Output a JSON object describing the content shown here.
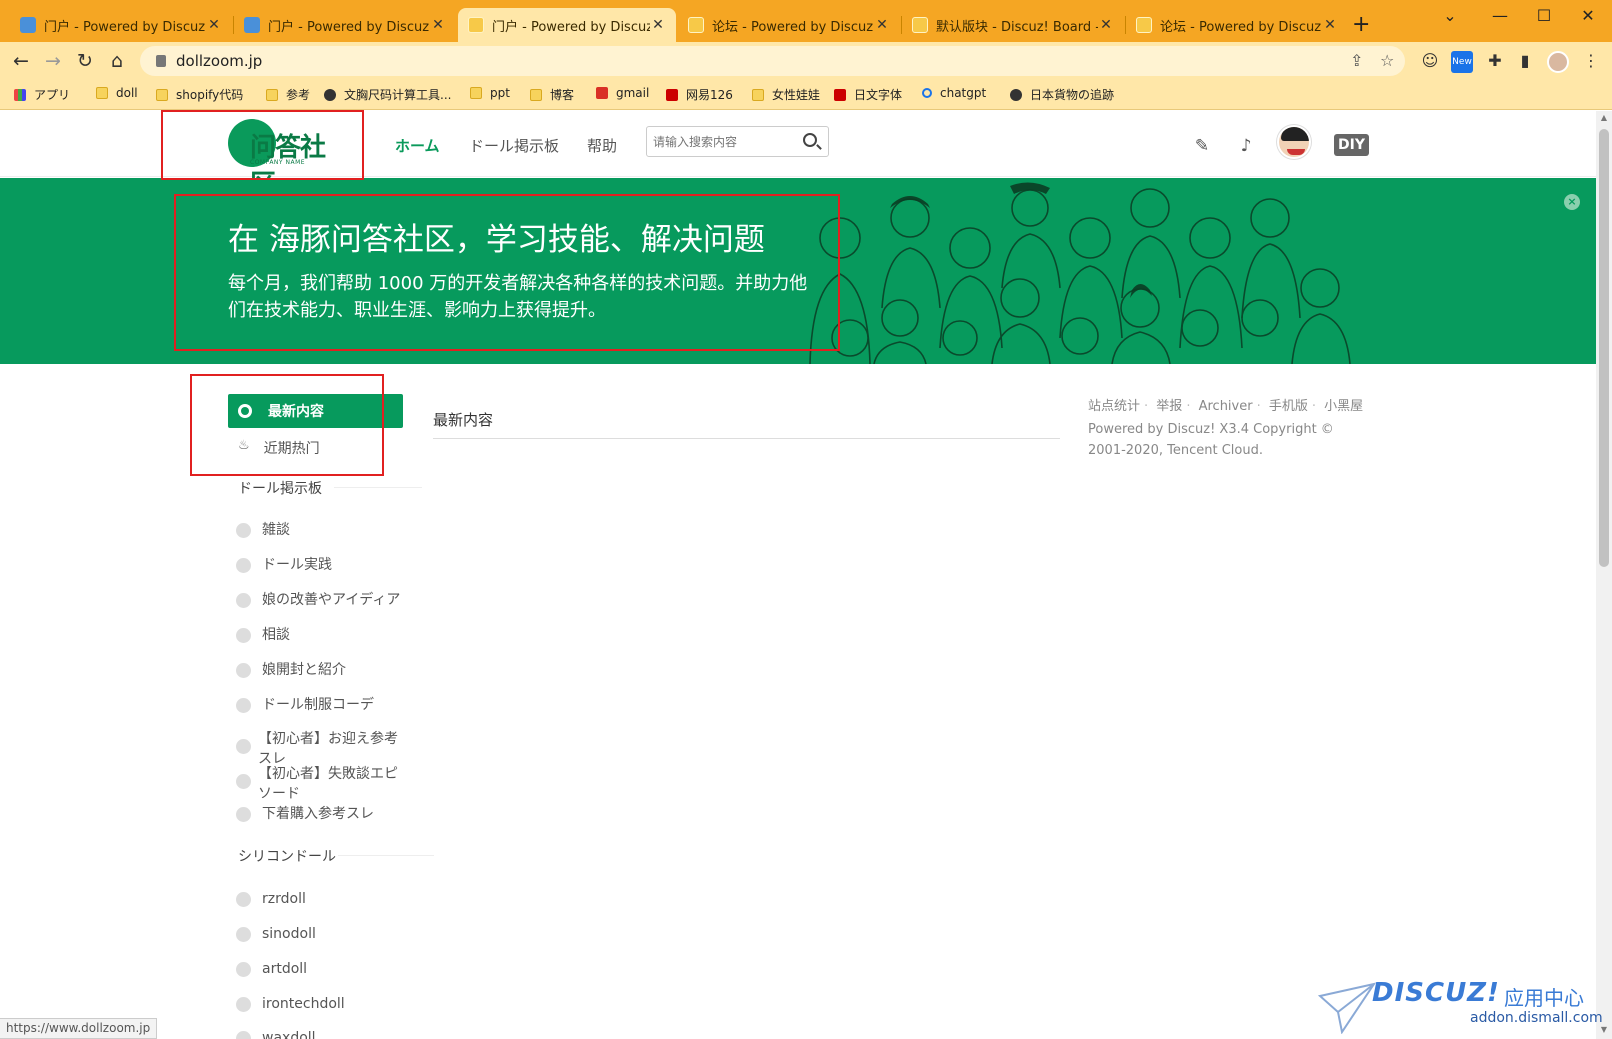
{
  "browser": {
    "tabs": [
      {
        "title": "门户 - Powered by Discuz!",
        "fav": "blue"
      },
      {
        "title": "门户 - Powered by Discuz!",
        "fav": "blue"
      },
      {
        "title": "门户 - Powered by Discuz!",
        "fav": "yel",
        "active": true
      },
      {
        "title": "论坛 - Powered by Discuz!",
        "fav": "yel"
      },
      {
        "title": "默认版块 - Discuz! Board - P",
        "fav": "yel"
      },
      {
        "title": "论坛 - Powered by Discuz!",
        "fav": "yel"
      }
    ],
    "url": "dollzoom.jp",
    "new_badge": "New",
    "bookmarks": [
      {
        "label": "アプリ",
        "icon": "grid"
      },
      {
        "label": "doll",
        "icon": "folder"
      },
      {
        "label": "shopify代码",
        "icon": "folder"
      },
      {
        "label": "参考",
        "icon": "folder"
      },
      {
        "label": "文胸尺码计算工具...",
        "icon": "dark"
      },
      {
        "label": "ppt",
        "icon": "folder"
      },
      {
        "label": "博客",
        "icon": "folder"
      },
      {
        "label": "gmail",
        "icon": "gm"
      },
      {
        "label": "网易126",
        "icon": "red"
      },
      {
        "label": "女性娃娃",
        "icon": "folder"
      },
      {
        "label": "日文字体",
        "icon": "red"
      },
      {
        "label": "chatgpt",
        "icon": "srch"
      },
      {
        "label": "日本貨物の追跡",
        "icon": "dark"
      }
    ],
    "status_url": "https://www.dollzoom.jp"
  },
  "header": {
    "logo_text": "问答社区",
    "logo_sub": "COMPANY NAME",
    "nav": [
      {
        "label": "ホーム",
        "active": true
      },
      {
        "label": "ドール掲示板"
      },
      {
        "label": "帮助"
      }
    ],
    "search_placeholder": "请输入搜索内容",
    "diy_label": "DIY"
  },
  "banner": {
    "title": "在 海豚问答社区，学习技能、解决问题",
    "subtitle": "每个月，我们帮助 1000 万的开发者解决各种各样的技术问题。并助力他们在技术能力、职业生涯、影响力上获得提升。",
    "close": "×"
  },
  "sidebar": {
    "active_label": "最新内容",
    "hot_label": "近期热门",
    "groups": [
      {
        "title": "ドール掲示板",
        "forums": [
          "雑談",
          "ドール実践",
          "娘の改善やアイディア",
          "相談",
          "娘開封と紹介",
          "ドール制服コーデ",
          "【初心者】お迎え参考スレ",
          "【初心者】失敗談エピソード",
          "下着購入参考スレ"
        ]
      },
      {
        "title": "シリコンドール",
        "forums": [
          "rzrdoll",
          "sinodoll",
          "artdoll",
          "irontechdoll",
          "waxdoll"
        ]
      }
    ]
  },
  "main": {
    "title": "最新内容"
  },
  "footer": {
    "links": [
      "站点统计",
      "举报",
      "Archiver",
      "手机版",
      "小黑屋"
    ],
    "copyright": "Powered by Discuz! X3.4 Copyright © 2001-2020, Tencent Cloud."
  },
  "watermark": {
    "brand": "DISCUZ!",
    "cn": "应用中心",
    "url": "addon.dismall.com"
  },
  "colors": {
    "brand_green": "#079a5d",
    "chrome_orange": "#f5a623",
    "annotation_red": "#e12020"
  }
}
